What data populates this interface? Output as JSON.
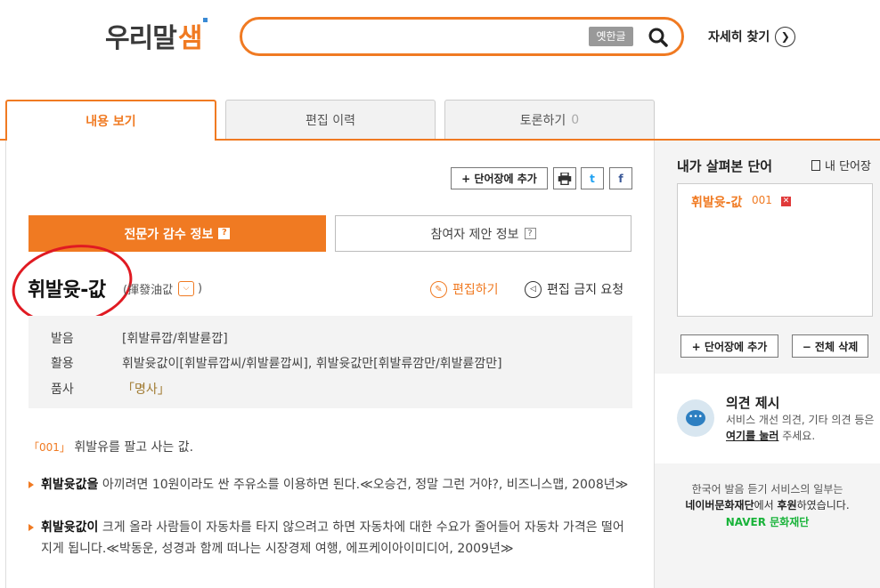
{
  "header": {
    "logo_text": "우리말",
    "logo_mark": "샘",
    "search_placeholder": "",
    "old_hangul_label": "옛한글",
    "detail_search_label": "자세히 찾기"
  },
  "tabs": {
    "view_label": "내용 보기",
    "history_label": "편집 이력",
    "discuss_label": "토론하기",
    "discuss_count": "0"
  },
  "toolbar": {
    "add_wordbook_label": "+ 단어장에 추가",
    "twitter_label": "t",
    "facebook_label": "f"
  },
  "subtabs": {
    "expert_label": "전문가 감수 정보",
    "participant_label": "참여자 제안 정보",
    "help_mark": "?"
  },
  "entry": {
    "headword": "휘발윳-값",
    "hanja": "(揮發油값",
    "hanja_close": ")",
    "edit_label": "편집하기",
    "block_label": "편집 금지 요청",
    "info": [
      {
        "label": "발음",
        "value": "[휘발류깝/휘발륟깝]"
      },
      {
        "label": "활용",
        "value": "휘발윳값이[휘발류깝씨/휘발륟깝씨], 휘발윳값만[휘발류깜만/휘발륟깜만]"
      },
      {
        "label": "품사",
        "value": "「명사」"
      }
    ],
    "sense_num": "「001」",
    "sense_text": "휘발유를 팔고 사는 값.",
    "examples": [
      {
        "bold": "휘발윳값을",
        "text": " 아끼려면 10원이라도 싼 주유소를 이용하면 된다.≪오승건, 정말 그런 거야?, 비즈니스맵, 2008년≫"
      },
      {
        "bold": "휘발윳값이",
        "text": " 크게 올라 사람들이 자동차를 타지 않으려고 하면 자동차에 대한 수요가 줄어들어 자동차 가격은 떨어지게 됩니다.≪박동운, 성경과 함께 떠나는 시장경제 여행, 에프케이아이미디어, 2009년≫"
      }
    ]
  },
  "side": {
    "recent_title": "내가 살펴본 단어",
    "my_wordbook_label": "내 단어장",
    "recent_word": "휘발윳-값",
    "recent_num": "001",
    "add_label": "+ 단어장에 추가",
    "clear_label": "− 전체 삭제",
    "opinion_title": "의견 제시",
    "opinion_desc_1": "서비스 개선 의견, 기타 의견 등은",
    "opinion_link": "여기를 눌러",
    "opinion_desc_2": " 주세요.",
    "sponsor_line1": "한국어 발음 듣기 서비스의 일부는",
    "sponsor_org": "네이버문화재단",
    "sponsor_line2a": "에서 ",
    "sponsor_line2b": "후원",
    "sponsor_line2c": "하였습니다.",
    "sponsor_brand": "NAVER 문화재단"
  },
  "colors": {
    "accent": "#f07a22",
    "annotation": "#e01a22"
  }
}
